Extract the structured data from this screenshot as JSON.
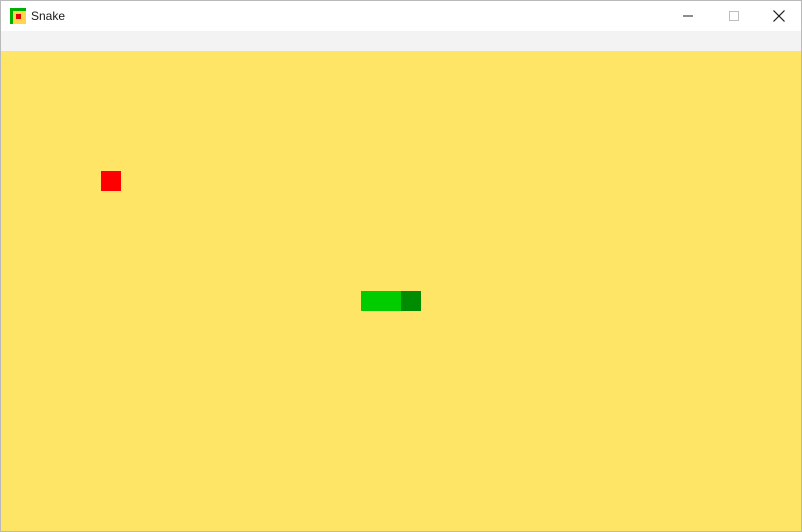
{
  "window": {
    "title": "Snake",
    "icon": "snake-app-icon",
    "controls": {
      "minimize_icon": "minimize-icon",
      "maximize_icon": "maximize-icon",
      "close_icon": "close-icon"
    }
  },
  "game": {
    "board_color": "#ffe566",
    "food_color": "#ff0000",
    "snake_body_color": "#00cc00",
    "snake_head_color": "#008c00",
    "grid_cell_units": 20,
    "food": {
      "col": 5,
      "row": 6
    },
    "snake": [
      {
        "col": 18,
        "row": 12,
        "part": "body"
      },
      {
        "col": 19,
        "row": 12,
        "part": "body"
      },
      {
        "col": 20,
        "row": 12,
        "part": "head"
      }
    ]
  }
}
